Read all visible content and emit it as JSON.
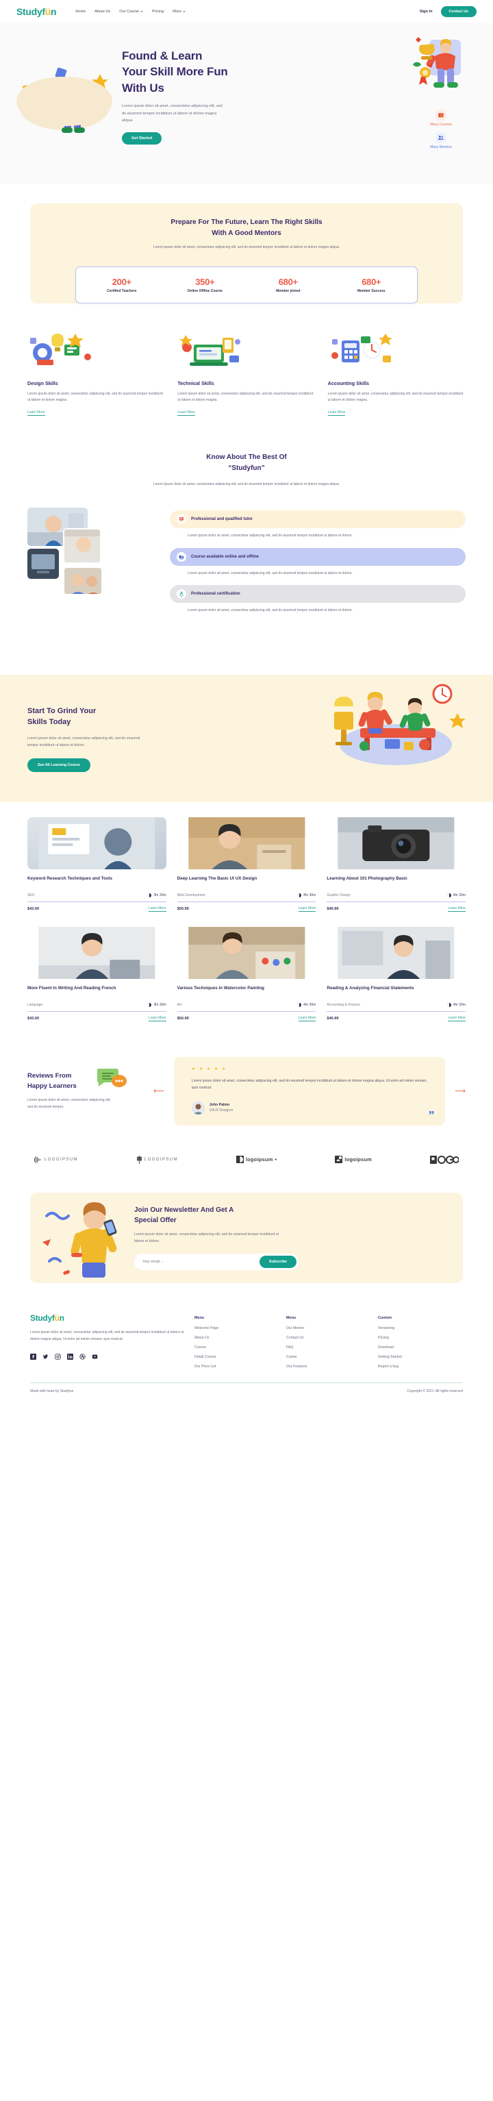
{
  "brand": {
    "name_part1": "Studyf",
    "name_accent": "ü",
    "name_part2": "n"
  },
  "header": {
    "nav": [
      {
        "label": "Home",
        "caret": false
      },
      {
        "label": "About Us",
        "caret": false
      },
      {
        "label": "Our Course",
        "caret": true
      },
      {
        "label": "Pricing",
        "caret": false
      },
      {
        "label": "More",
        "caret": true
      }
    ],
    "signin": "Sign in",
    "contact": "Contact Us"
  },
  "hero": {
    "title_line1": "Found & Learn",
    "title_line2": "Your Skill More Fun",
    "title_line3": "With Us",
    "paragraph": "Lorem ipsum dolor sit amet, consectetur adipiscing elit, sed do eiusmod tempor incididunt ut labore et dolore magna aliqua.",
    "cta": "Get Started",
    "badge_courses": "Many Courses",
    "badge_mentors": "Many Mentors",
    "icon_courses": "book-icon",
    "icon_mentors": "people-icon"
  },
  "prepare": {
    "heading_line1": "Prepare For The Future, Learn The Right Skills",
    "heading_line2": "With A Good Mentors",
    "paragraph": "Lorem ipsum dolor sit amet, consectetur adipiscing elit, sed do eiusmod tempor incididunt ut labore et dolore magna aliqua.",
    "stats": [
      {
        "number": "200+",
        "label": "Certified Teachers"
      },
      {
        "number": "350+",
        "label": "Online Offline Course"
      },
      {
        "number": "680+",
        "label": "Member joined"
      },
      {
        "number": "680+",
        "label": "Member Success"
      }
    ]
  },
  "skills": [
    {
      "title": "Design Skills",
      "paragraph": "Lorem ipsum dolor sit amet, consectetur adipiscing elit, sed do eiusmod tempor incididunt ut labore et dolore magna.",
      "link": "Learn More"
    },
    {
      "title": "Technical Skills",
      "paragraph": "Lorem ipsum dolor sit amet, consectetur adipiscing elit, sed do eiusmod tempor incididunt ut labore et dolore magna.",
      "link": "Learn More"
    },
    {
      "title": "Accounting Skills",
      "paragraph": "Lorem ipsum dolor sit amet, consectetur adipiscing elit, sed do eiusmod tempor incididunt ut labore et dolore magna.",
      "link": "Learn More"
    }
  ],
  "know": {
    "heading_line1": "Know About The Best Of",
    "heading_line2": "“Studyfun”",
    "paragraph": "Lorem ipsum dolor sit amet, consectetur adipiscing elit, sed do eiusmod tempor incididunt ut labore et dolore magna aliqua.",
    "features": [
      {
        "title": "Professional and qualified tutor",
        "paragraph": "Lorem ipsum dolor sit amet, consectetur adipiscing elit, sed do eiusmod tempor incididunt ut labore et dolore.",
        "icon": "certificate-icon"
      },
      {
        "title": "Course available online and offline",
        "paragraph": "Lorem ipsum dolor sit amet, consectetur adipiscing elit, sed do eiusmod tempor incididunt ut labore et dolore.",
        "icon": "devices-icon"
      },
      {
        "title": "Professional certification",
        "paragraph": "Lorem ipsum dolor sit amet, consectetur adipiscing elit, sed do eiusmod tempor incididunt ut labore et dolore.",
        "icon": "medal-icon"
      }
    ]
  },
  "grind": {
    "heading_line1": "Start To Grind Your",
    "heading_line2": "Skills Today",
    "paragraph": "Lorem ipsum dolor sit amet, consectetur adipiscing elit, sed do eiusmod tempor incididunt ut labore et dolore.",
    "cta": "See All Learning Course"
  },
  "courses": {
    "row1": [
      {
        "title": "Keyword Research Techniques and Tools",
        "category": "SEO",
        "duration": "3hr 30m",
        "price": "$43.00",
        "link": "Learn More"
      },
      {
        "title": "Deep Learning The Basic UI UX Design",
        "category": "Web Development",
        "duration": "4hr 30m",
        "price": "$50.99",
        "link": "Learn More"
      },
      {
        "title": "Learning About 101 Photography Basic",
        "category": "Graphic Design",
        "duration": "4hr 30m",
        "price": "$40.99",
        "link": "Learn More"
      }
    ],
    "row2": [
      {
        "title": "More Fluent In Writing And Reading French",
        "category": "Language",
        "duration": "3hr 30m",
        "price": "$43.00",
        "link": "Learn More"
      },
      {
        "title": "Various Techniques In Watercolor Painting",
        "category": "Art",
        "duration": "4hr 30m",
        "price": "$50.99",
        "link": "Learn More"
      },
      {
        "title": "Reading & Analyzing Financial Statements",
        "category": "Accounting & Finance",
        "duration": "4hr 30m",
        "price": "$40.99",
        "link": "Learn More"
      }
    ]
  },
  "reviews": {
    "heading_line1": "Reviews From",
    "heading_line2": "Happy Learners",
    "paragraph": "Lorem ipsum dolor sit amet, consectetur adipiscing elit, sed do eiusmod tempor.",
    "stars": "★ ★ ★ ★ ★",
    "quote": "Lorem ipsum dolor sit amet, consectetur adipiscing elit, sed do eiusmod tempor incididunt ut labore et dolore magna aliqua. Ut enim ad minim veniam, quis nostrud.",
    "author_name": "John Palmo",
    "author_role": "UI/UX Designer",
    "prev_icon": "arrow-left-icon",
    "next_icon": "arrow-right-icon"
  },
  "logos": [
    {
      "text": "LOGOIPSUM",
      "style": "thin"
    },
    {
      "text": "LOGOIPSUM",
      "style": "thin"
    },
    {
      "text": "logoipsum",
      "style": "bold"
    },
    {
      "text": "logoipsum",
      "style": "bold"
    },
    {
      "text": "LOGO",
      "style": "bold"
    }
  ],
  "newsletter": {
    "heading_line1": "Join Our Newsletter And Get A",
    "heading_line2": "Special Offer",
    "paragraph": "Lorem ipsum dolor sit amet, consectetur adipiscing elit, sed do eiusmod tempor incididunt ut labore et dolore.",
    "placeholder": "Your email ...",
    "cta": "Subscribe"
  },
  "footer": {
    "paragraph": "Lorem ipsum dolor sit amet, consectetur adipiscing elit, sed do eiusmod tempor incididunt ut labore et dolore magna aliqua. Ut enim ad minim veniam, quis nostrud.",
    "socials": [
      "facebook-icon",
      "twitter-icon",
      "instagram-icon",
      "linkedin-icon",
      "dribbble-icon",
      "youtube-icon"
    ],
    "columns": [
      {
        "heading": "Menu",
        "links": [
          "Welcome Page",
          "About Us",
          "Course",
          "Detail Course",
          "Our Price List"
        ]
      },
      {
        "heading": "Menu",
        "links": [
          "Our Mentor",
          "Contact Us",
          "FAQ",
          "Career",
          "Our Features"
        ]
      },
      {
        "heading": "Custom",
        "links": [
          "Versioning",
          "Pricing",
          "Download",
          "Getting Started",
          "Report a bug"
        ]
      }
    ],
    "made_by": "Made with heart by Studyfun",
    "copyright": "Copyright © 2021. All rights reserved"
  },
  "colors": {
    "brand_teal": "#15a08d",
    "brand_yellow": "#f2bd2a",
    "heading_purple": "#3b2a6b",
    "accent_red": "#ee5c4d",
    "cream": "#fdf4dd"
  }
}
